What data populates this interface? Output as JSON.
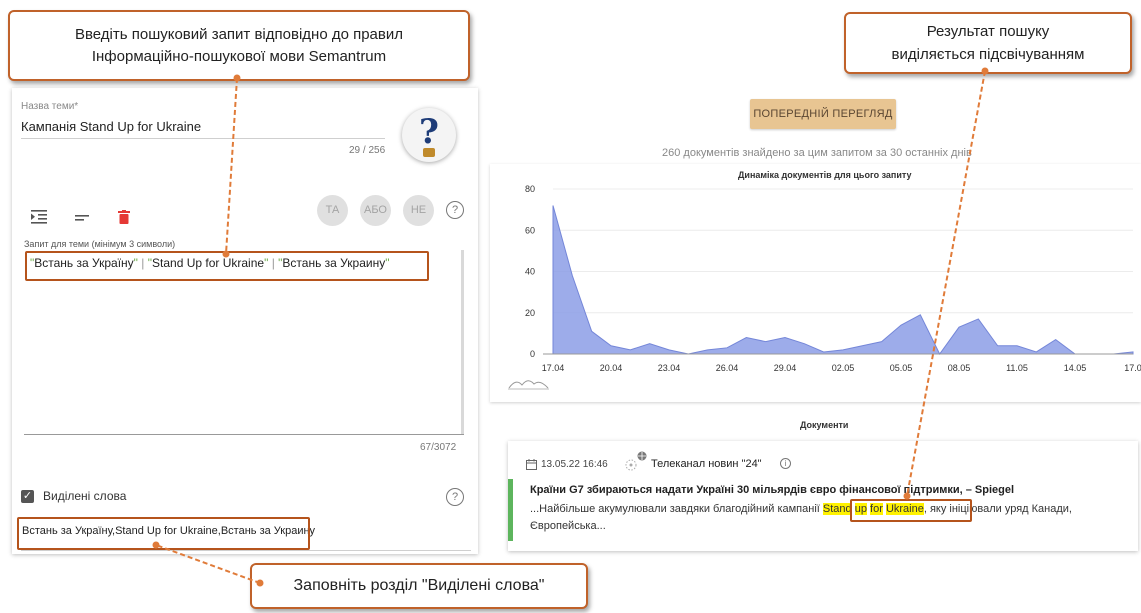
{
  "callouts": {
    "query_hint_line1": "Введіть пошуковий запит відповідно до правил",
    "query_hint_line2": "Інформаційно-пошукової  мови Semantrum",
    "result_hint_line1": "Результат пошуку",
    "result_hint_line2": "виділяється підсвічуванням",
    "highlight_hint": "Заповніть розділ \"Виділені слова\""
  },
  "topic": {
    "label": "Назва теми",
    "required_mark": "*",
    "value": "Кампанія Stand Up for Ukraine",
    "counter": "29 / 256"
  },
  "operators": [
    "ТА",
    "АБО",
    "НЕ"
  ],
  "query": {
    "label": "Запит для теми (мінімум 3 символи)",
    "terms": [
      "Встань за Україну",
      "Stand Up for Ukraine",
      "Встань за Украину"
    ],
    "separator": "|",
    "counter": "67/3072"
  },
  "highlight": {
    "label": "Виділені слова",
    "checked": true,
    "value": "Встань за Україну,Stand Up for Ukraine,Встань за Украину"
  },
  "preview_button": "ПОПЕРЕДНІЙ ПЕРЕГЛЯД",
  "found_text": "260 документів знайдено за цим запитом за 30 останніх днів",
  "chart_data": {
    "type": "area",
    "title": "Динаміка документів для цього запиту",
    "x_tick_labels": [
      "17.04",
      "20.04",
      "23.04",
      "26.04",
      "29.04",
      "02.05",
      "05.05",
      "08.05",
      "11.05",
      "14.05",
      "17.0"
    ],
    "y_ticks": [
      0,
      20,
      40,
      60,
      80
    ],
    "ylim": [
      0,
      80
    ],
    "x": [
      0,
      1,
      2,
      3,
      4,
      5,
      6,
      7,
      8,
      9,
      10,
      11,
      12,
      13,
      14,
      15,
      16,
      17,
      18,
      19,
      20,
      21,
      22,
      23,
      24,
      25,
      26,
      27,
      28,
      29,
      30
    ],
    "values": [
      72,
      38,
      11,
      4,
      2,
      5,
      2,
      0,
      2,
      3,
      8,
      6,
      8,
      5,
      1,
      2,
      4,
      6,
      14,
      19,
      0,
      13,
      17,
      4,
      4,
      1,
      7,
      0,
      0,
      0,
      1
    ],
    "color": "#8c9ee6"
  },
  "documents": {
    "title": "Документи",
    "items": [
      {
        "date": "13.05.22 16:46",
        "source": "Телеканал новин \"24\"",
        "headline": "Країни G7 збираються надати Україні 30 мільярдів євро фінансової підтримки, – Spiegel",
        "snippet_before": "...Найбільше акумулювали завдяки благодійний кампанії ",
        "snippet_hl": [
          "Stand",
          "up",
          "for",
          "Ukraine"
        ],
        "snippet_after": ", яку ініціювали уряд Канади, Європейська...",
        "accent_color": "#5db55d"
      }
    ]
  }
}
